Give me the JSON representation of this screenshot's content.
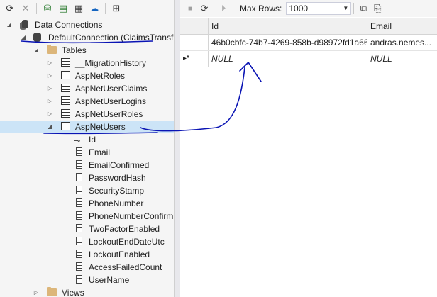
{
  "server_explorer": {
    "tree": {
      "data_connections": "Data Connections",
      "connection": "DefaultConnection (ClaimsTransf",
      "tables_folder": "Tables",
      "tables": [
        "__MigrationHistory",
        "AspNetRoles",
        "AspNetUserClaims",
        "AspNetUserLogins",
        "AspNetUserRoles"
      ],
      "selected_table": "AspNetUsers",
      "columns": [
        "Id",
        "Email",
        "EmailConfirmed",
        "PasswordHash",
        "SecurityStamp",
        "PhoneNumber",
        "PhoneNumberConfirm",
        "TwoFactorEnabled",
        "LockoutEndDateUtc",
        "LockoutEnabled",
        "AccessFailedCount",
        "UserName"
      ],
      "views_folder": "Views"
    }
  },
  "data_view": {
    "toolbar": {
      "max_rows_label": "Max Rows:",
      "max_rows_value": "1000"
    },
    "grid": {
      "columns": [
        "Id",
        "Email"
      ],
      "rows": [
        [
          "46b0cbfc-74b7-4269-858b-d98972fd1a66",
          "andras.nemes..."
        ]
      ],
      "new_row_marker": "▸*",
      "null_text": "NULL"
    }
  },
  "annotation": {
    "color": "#0a14b4"
  }
}
